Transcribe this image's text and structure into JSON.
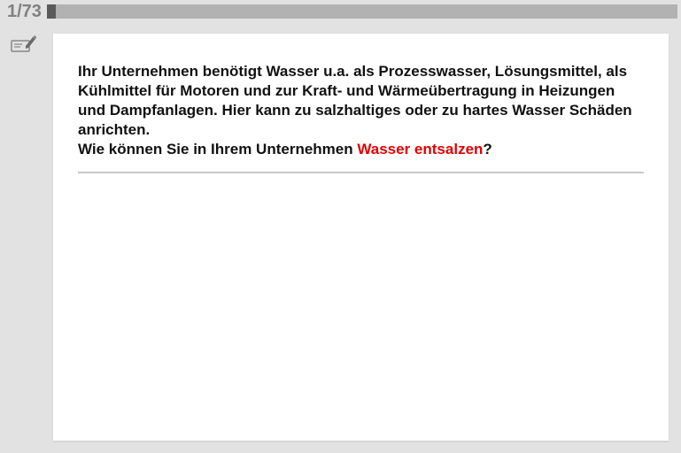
{
  "progress": {
    "current": 1,
    "total": 73,
    "label": "1/73",
    "fill_percent": 1.37
  },
  "question": {
    "intro1": "Ihr Unternehmen benötigt Wasser u.a. als Prozesswasser, Lösungsmittel, als Kühlmittel für Motoren und zur Kraft- und Wärmeübertragung in Heizungen und Dampfanlagen. Hier kann zu salzhaltiges oder zu hartes Wasser Schäden anrichten.",
    "prompt_prefix": "Wie können Sie in Ihrem Unternehmen ",
    "highlight": "Wasser entsalzen",
    "prompt_suffix": "?"
  },
  "icons": {
    "edit": "edit-icon"
  }
}
